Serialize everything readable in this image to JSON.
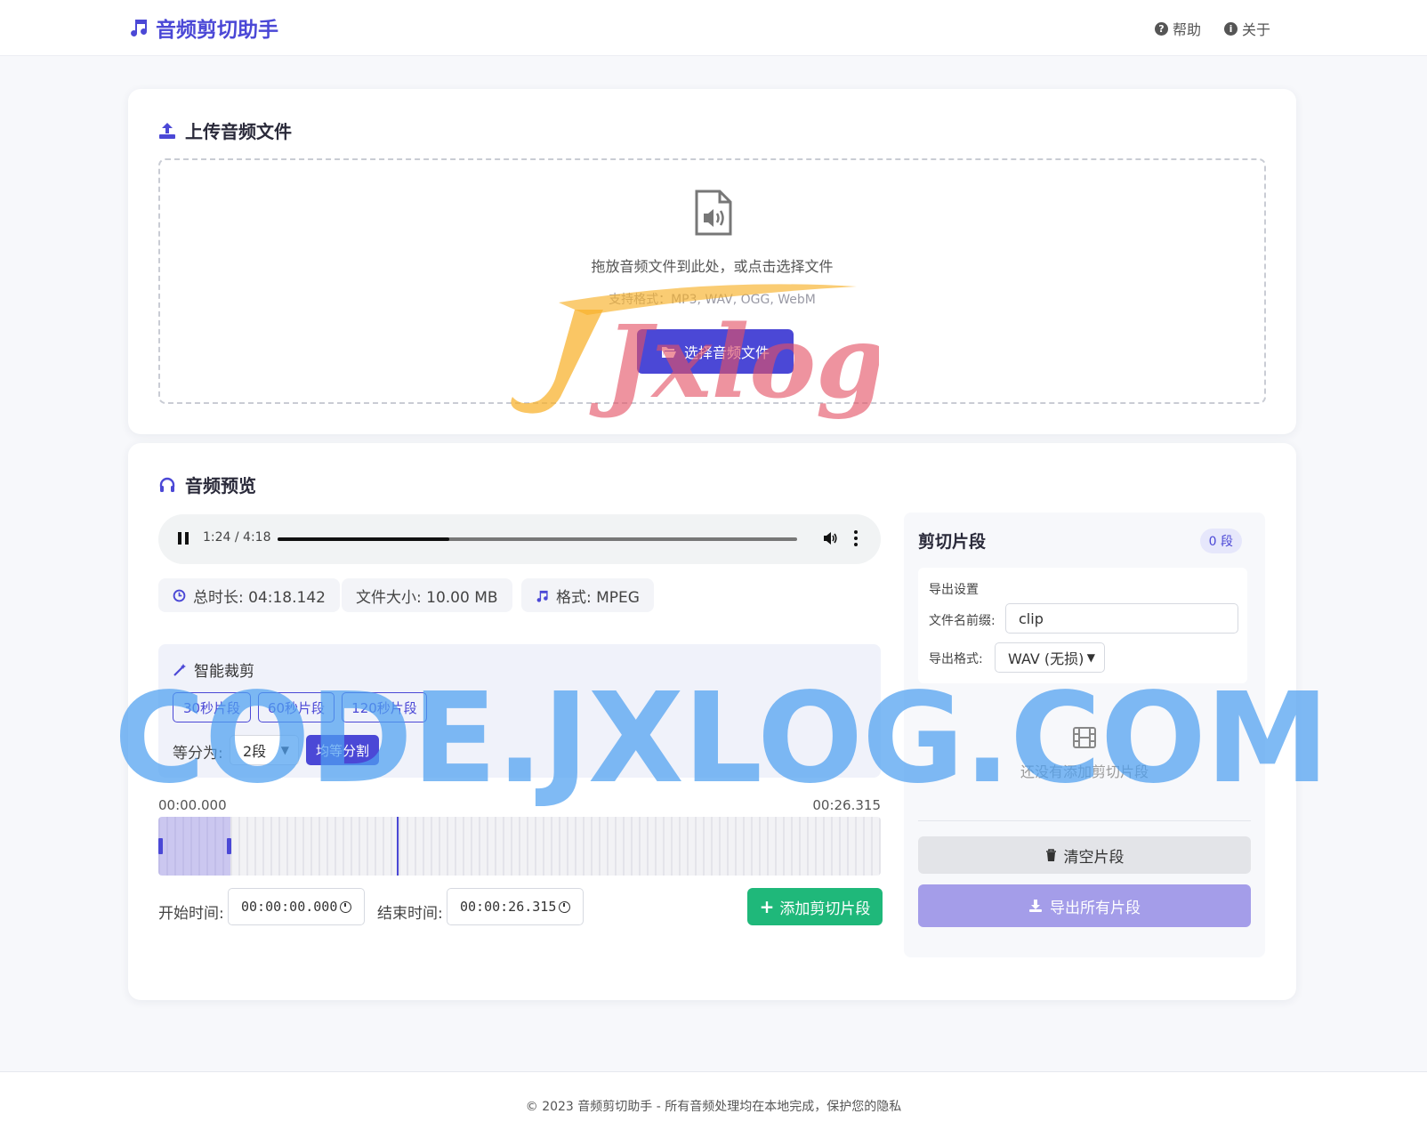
{
  "app": {
    "title": "音频剪切助手",
    "accent": "#4b48d6",
    "green": "#1fb87a"
  },
  "nav": [
    {
      "label": "帮助",
      "icon": "question-circle-icon"
    },
    {
      "label": "关于",
      "icon": "info-circle-icon"
    }
  ],
  "upload": {
    "title": "上传音频文件",
    "drop_text": "拖放音频文件到此处，或点击选择文件",
    "formats": "支持格式：MP3, WAV, OGG, WebM",
    "button": "选择音频文件"
  },
  "preview": {
    "title": "音频预览",
    "player": {
      "time": "1:24 / 4:18",
      "progress": 0.33
    },
    "info": {
      "duration": "总时长: 04:18.142",
      "size": "文件大小: 10.00 MB",
      "format": "格式: MPEG"
    },
    "smart": {
      "title": "智能裁剪",
      "presets": [
        "30秒片段",
        "60秒片段",
        "120秒片段"
      ],
      "divide_label": "等分为:",
      "divide_value": "2段",
      "divide_button": "均等分割"
    },
    "timeline": {
      "start_label": "00:00.000",
      "end_label": "00:26.315",
      "selection_fraction": 0.1,
      "cursor_fraction": 0.33
    },
    "start_time": {
      "label": "开始时间:",
      "value": "00:00:00.000"
    },
    "end_time": {
      "label": "结束时间:",
      "value": "00:00:26.315"
    },
    "add_button": "添加剪切片段"
  },
  "clips": {
    "title": "剪切片段",
    "count": "0 段",
    "export_title": "导出设置",
    "prefix_label": "文件名前缀:",
    "prefix_value": "clip",
    "format_label": "导出格式:",
    "format_value": "WAV (无损)",
    "empty_text": "还没有添加剪切片段",
    "clear_button": "清空片段",
    "export_button": "导出所有片段"
  },
  "footer": "© 2023 音频剪切助手 - 所有音频处理均在本地完成，保护您的隐私",
  "watermark": {
    "logo": "Jxlog",
    "site": "CODE.JXLOG.COM"
  }
}
